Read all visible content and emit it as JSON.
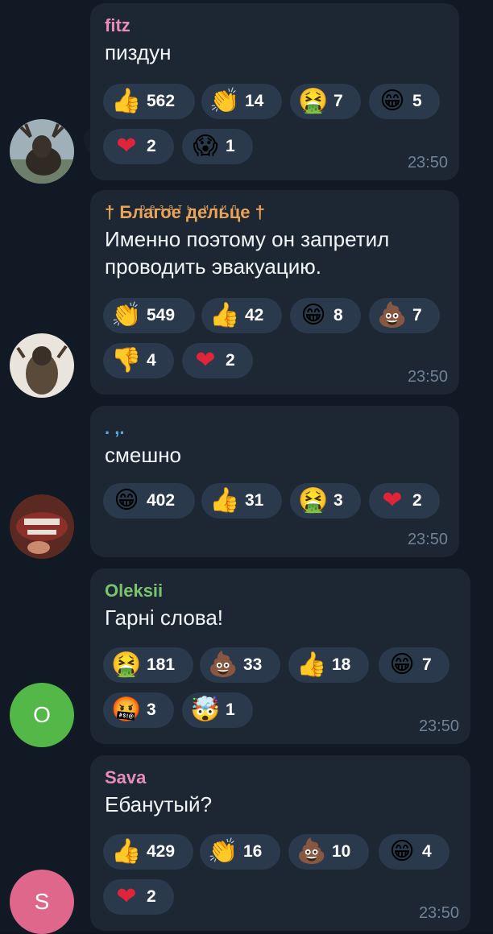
{
  "colors": {
    "background": "#0e1621",
    "bubble": "#1c2733",
    "chip": "#2a3a4c",
    "time": "#6f8296"
  },
  "messages": [
    {
      "sender": "fitz",
      "sender_color": "#e68db9",
      "text": "пиздун",
      "time": "23:50",
      "avatar": {
        "type": "photo",
        "desc": "moose-photo"
      },
      "reactions": [
        {
          "emoji": "👍",
          "icon": "thumbs-up-icon",
          "count": "562"
        },
        {
          "emoji": "👏",
          "icon": "clap-icon",
          "count": "14"
        },
        {
          "emoji": "🤮",
          "icon": "vomit-face-icon",
          "count": "7"
        },
        {
          "emoji": "😁",
          "icon": "grin-face-icon",
          "count": "5"
        },
        {
          "emoji": "❤",
          "icon": "heart-icon",
          "count": "2"
        },
        {
          "emoji": "😱",
          "icon": "scream-face-icon",
          "count": "1"
        }
      ]
    },
    {
      "sender": "† Благое дельце †",
      "sender_overlay": "резать игил",
      "sender_color": "#e9a45a",
      "text": "Именно поэтому он запретил\nпроводить эвакуацию.",
      "time": "23:50",
      "avatar": {
        "type": "photo",
        "desc": "soldier-photo"
      },
      "reactions": [
        {
          "emoji": "👏",
          "icon": "clap-icon",
          "count": "549"
        },
        {
          "emoji": "👍",
          "icon": "thumbs-up-icon",
          "count": "42"
        },
        {
          "emoji": "😁",
          "icon": "grin-face-icon",
          "count": "8"
        },
        {
          "emoji": "💩",
          "icon": "poop-icon",
          "count": "7"
        },
        {
          "emoji": "👎",
          "icon": "thumbs-down-icon",
          "count": "4"
        },
        {
          "emoji": "❤",
          "icon": "heart-icon",
          "count": "2"
        }
      ]
    },
    {
      "sender": ". ,.",
      "sender_color": "#5fa8e0",
      "text": "смешно",
      "time": "23:50",
      "avatar": {
        "type": "photo",
        "desc": "mouth-photo"
      },
      "reactions": [
        {
          "emoji": "😁",
          "icon": "grin-face-icon",
          "count": "402"
        },
        {
          "emoji": "👍",
          "icon": "thumbs-up-icon",
          "count": "31"
        },
        {
          "emoji": "🤮",
          "icon": "vomit-face-icon",
          "count": "3"
        },
        {
          "emoji": "❤",
          "icon": "heart-icon",
          "count": "2"
        }
      ]
    },
    {
      "sender": "Oleksii",
      "sender_color": "#7ac36f",
      "text": "Гарні слова!",
      "time": "23:50",
      "avatar": {
        "type": "letter",
        "letter": "O",
        "color": "#54b848"
      },
      "reactions": [
        {
          "emoji": "🤮",
          "icon": "vomit-face-icon",
          "count": "181"
        },
        {
          "emoji": "💩",
          "icon": "poop-icon",
          "count": "33"
        },
        {
          "emoji": "👍",
          "icon": "thumbs-up-icon",
          "count": "18"
        },
        {
          "emoji": "😁",
          "icon": "grin-face-icon",
          "count": "7"
        },
        {
          "emoji": "🤬",
          "icon": "cursing-face-icon",
          "count": "3"
        },
        {
          "emoji": "🤯",
          "icon": "exploding-head-icon",
          "count": "1"
        }
      ]
    },
    {
      "sender": "Sava",
      "sender_color": "#e68db9",
      "text": "Ебанутый?",
      "time": "23:50",
      "avatar": {
        "type": "letter",
        "letter": "S",
        "color": "#e0678c"
      },
      "reactions": [
        {
          "emoji": "👍",
          "icon": "thumbs-up-icon",
          "count": "429"
        },
        {
          "emoji": "👏",
          "icon": "clap-icon",
          "count": "16"
        },
        {
          "emoji": "💩",
          "icon": "poop-icon",
          "count": "10"
        },
        {
          "emoji": "😁",
          "icon": "grin-face-icon",
          "count": "4"
        },
        {
          "emoji": "❤",
          "icon": "heart-icon",
          "count": "2"
        }
      ]
    }
  ]
}
